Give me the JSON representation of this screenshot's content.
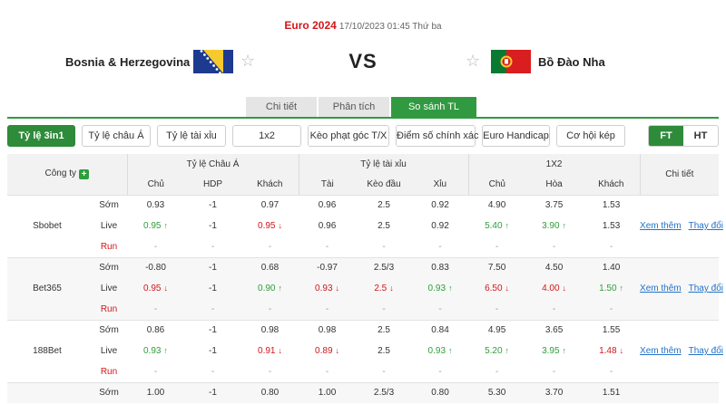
{
  "match": {
    "league": "Euro 2024",
    "datetime": "17/10/2023 01:45 Thứ ba",
    "home": "Bosnia & Herzegovina",
    "away": "Bồ Đào Nha",
    "vs": "VS",
    "star_glyph": "☆"
  },
  "tabs": [
    {
      "label": "Chi tiết",
      "active": false
    },
    {
      "label": "Phân tích",
      "active": false
    },
    {
      "label": "So sánh TL",
      "active": true
    }
  ],
  "toolbar": {
    "buttons": [
      "Tỷ lệ 3in1",
      "Tỷ lệ châu Á",
      "Tỷ lệ tài xỉu",
      "1x2",
      "Kèo phạt góc T/X",
      "Điểm số chính xác",
      "Euro Handicap",
      "Cơ hội kép"
    ],
    "active_index": 0,
    "ft": "FT",
    "ht": "HT"
  },
  "table": {
    "company_header": "Công ty",
    "plus_glyph": "+",
    "groups": [
      "Tỷ lệ Châu Á",
      "Tỷ lệ tài xỉu",
      "1X2"
    ],
    "detail_header": "Chi tiết",
    "subheaders": [
      "Chủ",
      "HDP",
      "Khách",
      "Tài",
      "Kèo đầu",
      "Xỉu",
      "Chủ",
      "Hòa",
      "Khách"
    ],
    "row_labels": {
      "early": "Sớm",
      "live": "Live",
      "run": "Run"
    },
    "link_more": "Xem thêm",
    "link_change": "Thay đổi",
    "arrow_up": "↑",
    "arrow_down": "↓",
    "companies": [
      {
        "name": "Sbobet",
        "rows": [
          {
            "type": "early",
            "cells": [
              {
                "v": "0.93"
              },
              {
                "v": "-1"
              },
              {
                "v": "0.97"
              },
              {
                "v": "0.96"
              },
              {
                "v": "2.5"
              },
              {
                "v": "0.92"
              },
              {
                "v": "4.90"
              },
              {
                "v": "3.75"
              },
              {
                "v": "1.53"
              }
            ]
          },
          {
            "type": "live",
            "cells": [
              {
                "v": "0.95",
                "t": "up"
              },
              {
                "v": "-1"
              },
              {
                "v": "0.95",
                "t": "down"
              },
              {
                "v": "0.96"
              },
              {
                "v": "2.5"
              },
              {
                "v": "0.92"
              },
              {
                "v": "5.40",
                "t": "up"
              },
              {
                "v": "3.90",
                "t": "up"
              },
              {
                "v": "1.53"
              }
            ]
          },
          {
            "type": "run",
            "cells": [
              {
                "v": "-"
              },
              {
                "v": "-"
              },
              {
                "v": "-"
              },
              {
                "v": "-"
              },
              {
                "v": "-"
              },
              {
                "v": "-"
              },
              {
                "v": "-"
              },
              {
                "v": "-"
              },
              {
                "v": "-"
              }
            ]
          }
        ]
      },
      {
        "name": "Bet365",
        "rows": [
          {
            "type": "early",
            "cells": [
              {
                "v": "-0.80"
              },
              {
                "v": "-1"
              },
              {
                "v": "0.68"
              },
              {
                "v": "-0.97"
              },
              {
                "v": "2.5/3"
              },
              {
                "v": "0.83"
              },
              {
                "v": "7.50"
              },
              {
                "v": "4.50"
              },
              {
                "v": "1.40"
              }
            ]
          },
          {
            "type": "live",
            "cells": [
              {
                "v": "0.95",
                "t": "down"
              },
              {
                "v": "-1"
              },
              {
                "v": "0.90",
                "t": "up"
              },
              {
                "v": "0.93",
                "t": "down"
              },
              {
                "v": "2.5",
                "t": "down"
              },
              {
                "v": "0.93",
                "t": "up"
              },
              {
                "v": "6.50",
                "t": "down"
              },
              {
                "v": "4.00",
                "t": "down"
              },
              {
                "v": "1.50",
                "t": "up"
              }
            ]
          },
          {
            "type": "run",
            "cells": [
              {
                "v": "-"
              },
              {
                "v": "-"
              },
              {
                "v": "-"
              },
              {
                "v": "-"
              },
              {
                "v": "-"
              },
              {
                "v": "-"
              },
              {
                "v": "-"
              },
              {
                "v": "-"
              },
              {
                "v": "-"
              }
            ]
          }
        ]
      },
      {
        "name": "188Bet",
        "rows": [
          {
            "type": "early",
            "cells": [
              {
                "v": "0.86"
              },
              {
                "v": "-1"
              },
              {
                "v": "0.98"
              },
              {
                "v": "0.98"
              },
              {
                "v": "2.5"
              },
              {
                "v": "0.84"
              },
              {
                "v": "4.95"
              },
              {
                "v": "3.65"
              },
              {
                "v": "1.55"
              }
            ]
          },
          {
            "type": "live",
            "cells": [
              {
                "v": "0.93",
                "t": "up"
              },
              {
                "v": "-1"
              },
              {
                "v": "0.91",
                "t": "down"
              },
              {
                "v": "0.89",
                "t": "down"
              },
              {
                "v": "2.5"
              },
              {
                "v": "0.93",
                "t": "up"
              },
              {
                "v": "5.20",
                "t": "up"
              },
              {
                "v": "3.95",
                "t": "up"
              },
              {
                "v": "1.48",
                "t": "down"
              }
            ]
          },
          {
            "type": "run",
            "cells": [
              {
                "v": "-"
              },
              {
                "v": "-"
              },
              {
                "v": "-"
              },
              {
                "v": "-"
              },
              {
                "v": "-"
              },
              {
                "v": "-"
              },
              {
                "v": "-"
              },
              {
                "v": "-"
              },
              {
                "v": "-"
              }
            ]
          }
        ]
      },
      {
        "name": "",
        "rows": [
          {
            "type": "early",
            "cells": [
              {
                "v": "1.00"
              },
              {
                "v": "-1"
              },
              {
                "v": "0.80"
              },
              {
                "v": "1.00"
              },
              {
                "v": "2.5/3"
              },
              {
                "v": "0.80"
              },
              {
                "v": "5.30"
              },
              {
                "v": "3.70"
              },
              {
                "v": "1.51"
              }
            ]
          }
        ]
      }
    ]
  },
  "colors": {
    "accent_green": "#319a41",
    "league_red": "#d0171b",
    "up_green": "#2e9e3c",
    "down_red": "#d0171b",
    "link_blue": "#2273c9"
  }
}
